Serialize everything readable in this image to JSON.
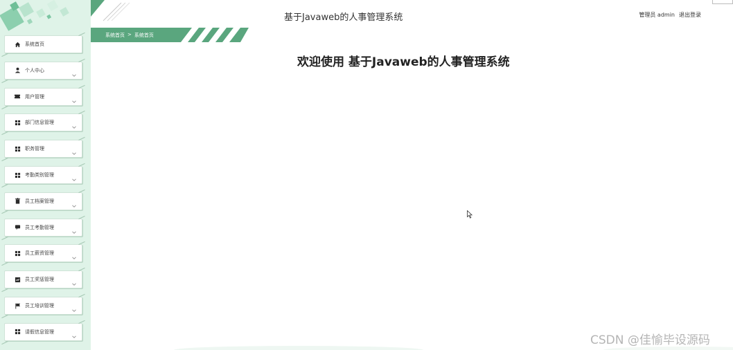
{
  "header": {
    "app_title": "基于Javaweb的人事管理系统",
    "user_role": "管理员 admin",
    "logout": "退出登录"
  },
  "breadcrumb": {
    "root": "系统首页",
    "separator": ">",
    "current": "系统首页"
  },
  "main": {
    "welcome": "欢迎使用 基于Javaweb的人事管理系统"
  },
  "sidebar": {
    "items": [
      {
        "label": "系统首页",
        "icon": "home-icon",
        "has_submenu": false
      },
      {
        "label": "个人中心",
        "icon": "person-icon",
        "has_submenu": true
      },
      {
        "label": "用户管理",
        "icon": "ticket-icon",
        "has_submenu": true
      },
      {
        "label": "部门信息管理",
        "icon": "grid-icon",
        "has_submenu": true
      },
      {
        "label": "职务管理",
        "icon": "grid-icon",
        "has_submenu": true
      },
      {
        "label": "考勤类别管理",
        "icon": "grid-icon",
        "has_submenu": true
      },
      {
        "label": "员工档案管理",
        "icon": "trash-icon",
        "has_submenu": true
      },
      {
        "label": "员工考勤管理",
        "icon": "chat-icon",
        "has_submenu": true
      },
      {
        "label": "员工薪资管理",
        "icon": "grid-icon",
        "has_submenu": true
      },
      {
        "label": "员工奖惩管理",
        "icon": "chart-icon",
        "has_submenu": true
      },
      {
        "label": "员工培训管理",
        "icon": "flag-icon",
        "has_submenu": true
      },
      {
        "label": "请假信息管理",
        "icon": "grid-icon",
        "has_submenu": true
      }
    ]
  },
  "watermark": "CSDN @佳愉毕设源码",
  "colors": {
    "sidebar_bg": "#dff3e8",
    "accent_green": "#5aa67e",
    "icon_dark": "#2b2b2b"
  }
}
